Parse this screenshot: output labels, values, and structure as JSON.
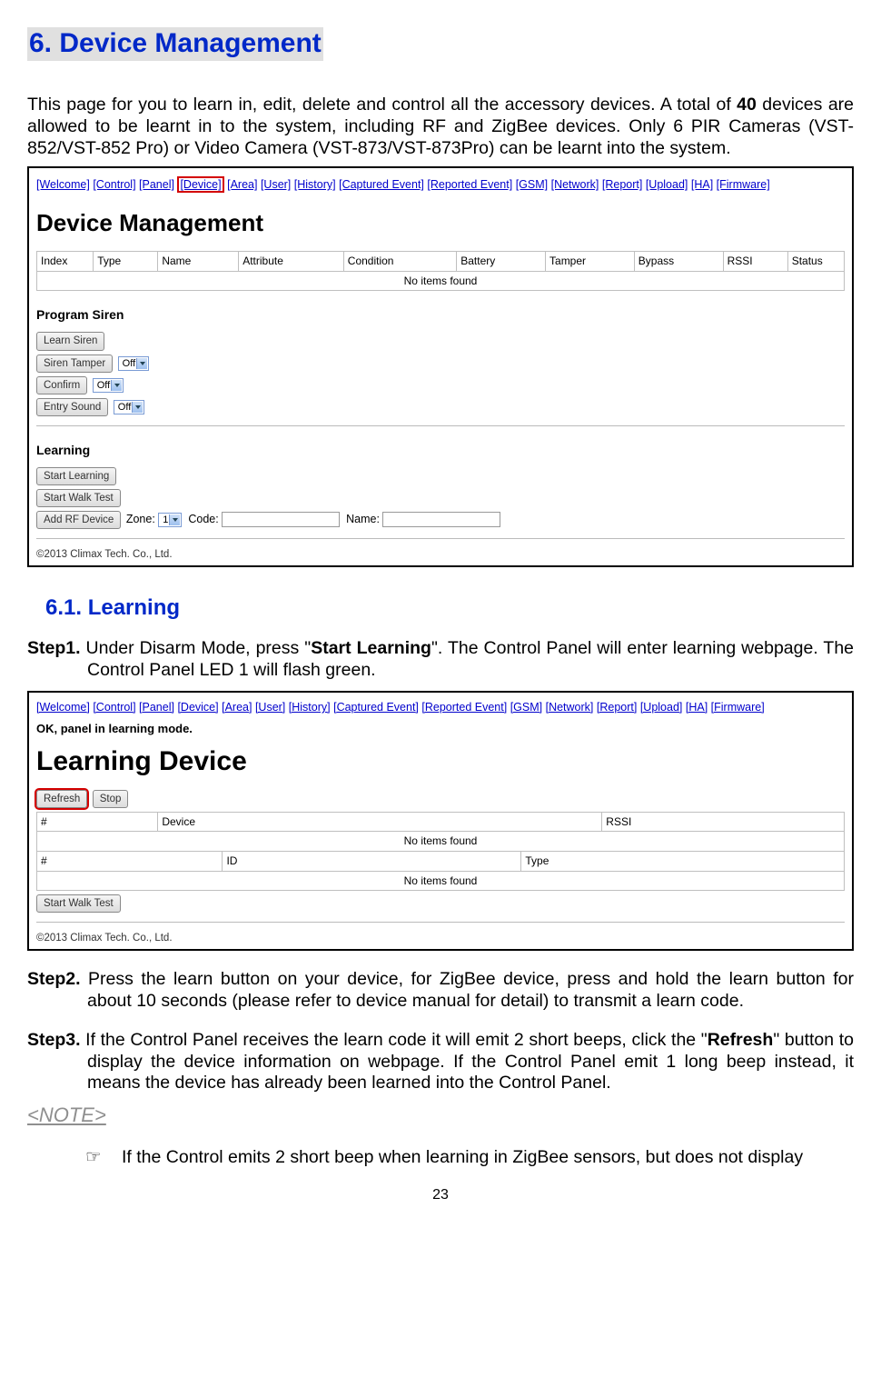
{
  "section_title": "6. Device Management",
  "intro_1": "This page for you to learn in, edit, delete and control all the accessory devices. A total of ",
  "intro_bold": "40",
  "intro_2": " devices are allowed to be learnt in to the system, including RF and ZigBee devices. Only 6 PIR Cameras (VST-852/VST-852 Pro) or Video Camera (VST-873/VST-873Pro) can be learnt into the system.",
  "shot1": {
    "nav": [
      "[Welcome]",
      "[Control]",
      "[Panel]",
      "[Device]",
      "[Area]",
      "[User]",
      "[History]",
      "[Captured Event]",
      "[Reported Event]",
      "[GSM]",
      "[Network]",
      "[Report]",
      "[Upload]",
      "[HA]",
      "[Firmware]"
    ],
    "highlight_index": 3,
    "title": "Device Management",
    "table_headers": [
      "Index",
      "Type",
      "Name",
      "Attribute",
      "Condition",
      "Battery",
      "Tamper",
      "Bypass",
      "RSSI",
      "Status"
    ],
    "table_empty": "No items found",
    "program_siren_heading": "Program Siren",
    "learn_siren_btn": "Learn Siren",
    "siren_tamper_label": "Siren Tamper",
    "siren_tamper_value": "Off",
    "confirm_label": "Confirm",
    "confirm_value": "Off",
    "entry_sound_label": "Entry Sound",
    "entry_sound_value": "Off",
    "learning_heading": "Learning",
    "start_learning_btn": "Start Learning",
    "start_walk_test_btn": "Start Walk Test",
    "add_rf_btn": "Add RF Device",
    "zone_label": "Zone:",
    "zone_value": "1",
    "code_label": "Code:",
    "name_label": "Name:",
    "copyright": "©2013 Climax Tech. Co., Ltd."
  },
  "subsection_title": "6.1. Learning",
  "step1_num": "Step1.",
  "step1_a": " Under Disarm Mode, press \"",
  "step1_bold": "Start Learning",
  "step1_b": "\". The Control Panel will enter learning webpage. The Control Panel LED 1 will flash green.",
  "shot2": {
    "nav": [
      "[Welcome]",
      "[Control]",
      "[Panel]",
      "[Device]",
      "[Area]",
      "[User]",
      "[History]",
      "[Captured Event]",
      "[Reported Event]",
      "[GSM]",
      "[Network]",
      "[Report]",
      "[Upload]",
      "[HA]",
      "[Firmware]"
    ],
    "status": "OK, panel in learning mode.",
    "title": "Learning Device",
    "refresh_btn": "Refresh",
    "stop_btn": "Stop",
    "t1_headers": [
      "#",
      "Device",
      "RSSI"
    ],
    "t1_empty": "No items found",
    "t2_headers": [
      "#",
      "ID",
      "Type"
    ],
    "t2_empty": "No items found",
    "start_walk_test_btn": "Start Walk Test",
    "copyright": "©2013 Climax Tech. Co., Ltd."
  },
  "step2_num": "Step2.",
  "step2_text": " Press the learn button on your device, for ZigBee device, press and hold the learn button for about 10 seconds (please refer to device manual for detail) to transmit a learn code.",
  "step3_num": "Step3.",
  "step3_a": " If the Control Panel receives the learn code it will emit 2 short beeps, click the \"",
  "step3_bold": "Refresh",
  "step3_b": "\" button to display the device information on webpage. If the Control Panel emit 1 long beep instead, it means the device has already been learned into the Control Panel.",
  "note_heading": "<NOTE>",
  "note_bullet": "If the Control emits 2 short beep when learning in ZigBee sensors, but does not display",
  "page_number": "23"
}
